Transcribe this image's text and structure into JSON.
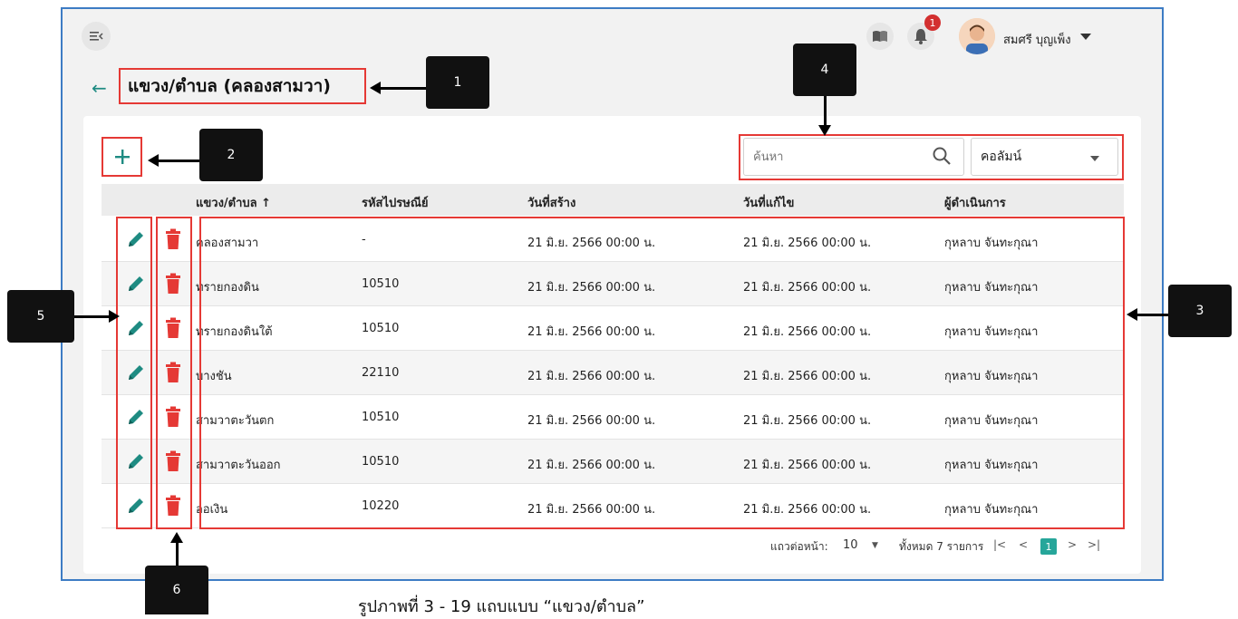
{
  "header": {
    "username": "สมศรี บุญเพ็ง",
    "notification_count": "1"
  },
  "page": {
    "title": "แขวง/ตำบล (คลองสามวา)"
  },
  "search": {
    "placeholder": "ค้นหา",
    "column_select": "คอลัมน์"
  },
  "table": {
    "columns": [
      "แขวง/ตำบล ↑",
      "รหัสไปรษณีย์",
      "วันที่สร้าง",
      "วันที่แก้ไข",
      "ผู้ดำเนินการ"
    ],
    "rows": [
      {
        "name": "คลองสามวา",
        "postcode": "-",
        "created": "21 มิ.ย. 2566 00:00 น.",
        "modified": "21 มิ.ย. 2566 00:00 น.",
        "operator": "กุหลาบ จันทะกุณา"
      },
      {
        "name": "ทรายกองดิน",
        "postcode": "10510",
        "created": "21 มิ.ย. 2566 00:00 น.",
        "modified": "21 มิ.ย. 2566 00:00 น.",
        "operator": "กุหลาบ จันทะกุณา"
      },
      {
        "name": "ทรายกองดินใต้",
        "postcode": "10510",
        "created": "21 มิ.ย. 2566 00:00 น.",
        "modified": "21 มิ.ย. 2566 00:00 น.",
        "operator": "กุหลาบ จันทะกุณา"
      },
      {
        "name": "บางชัน",
        "postcode": "22110",
        "created": "21 มิ.ย. 2566 00:00 น.",
        "modified": "21 มิ.ย. 2566 00:00 น.",
        "operator": "กุหลาบ จันทะกุณา"
      },
      {
        "name": "สามวาตะวันตก",
        "postcode": "10510",
        "created": "21 มิ.ย. 2566 00:00 น.",
        "modified": "21 มิ.ย. 2566 00:00 น.",
        "operator": "กุหลาบ จันทะกุณา"
      },
      {
        "name": "สามวาตะวันออก",
        "postcode": "10510",
        "created": "21 มิ.ย. 2566 00:00 น.",
        "modified": "21 มิ.ย. 2566 00:00 น.",
        "operator": "กุหลาบ จันทะกุณา"
      },
      {
        "name": "ออเงิน",
        "postcode": "10220",
        "created": "21 มิ.ย. 2566 00:00 น.",
        "modified": "21 มิ.ย. 2566 00:00 น.",
        "operator": "กุหลาบ จันทะกุณา"
      }
    ]
  },
  "pagination": {
    "rows_per_page_label": "แถวต่อหน้า:",
    "rows_per_page_value": "10",
    "total_label": "ทั้งหมด 7 รายการ",
    "current_page": "1"
  },
  "callouts": [
    "1",
    "2",
    "3",
    "4",
    "5",
    "6"
  ],
  "caption": "รูปภาพที่ 3 - 19 แถบแบบ “แขวง/ตำบล”",
  "colors": {
    "accent": "#1e8b82",
    "highlight": "#e53935",
    "delete": "#e53935",
    "frame": "#3d7cc4"
  }
}
